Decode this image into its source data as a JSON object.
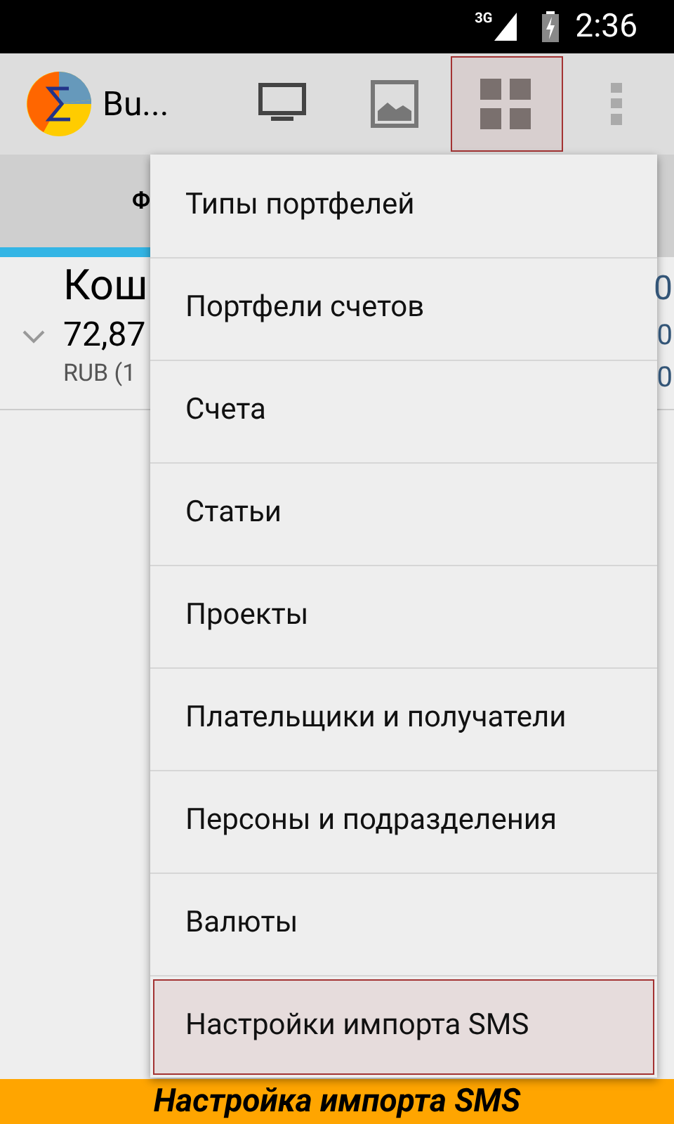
{
  "status_bar": {
    "network": "3G",
    "time": "2:36"
  },
  "action_bar": {
    "title": "Bu...",
    "actions": [
      {
        "kind": "monitor",
        "selected": false
      },
      {
        "kind": "image",
        "selected": false
      },
      {
        "kind": "grid",
        "selected": true
      }
    ]
  },
  "tabs": [
    {
      "label": "Ф",
      "selected": true
    }
  ],
  "list": [
    {
      "title": "Кош",
      "amount": "72,87",
      "currency": "RUB (1",
      "right_values": [
        "0",
        "0",
        "0"
      ]
    }
  ],
  "menu": [
    {
      "label": "Типы портфелей",
      "selected": false
    },
    {
      "label": "Портфели счетов",
      "selected": false
    },
    {
      "label": "Счета",
      "selected": false
    },
    {
      "label": "Статьи",
      "selected": false
    },
    {
      "label": "Проекты",
      "selected": false
    },
    {
      "label": "Плательщики и получатели",
      "selected": false
    },
    {
      "label": "Персоны и подразделения",
      "selected": false
    },
    {
      "label": "Валюты",
      "selected": false
    },
    {
      "label": "Настройки импорта SMS",
      "selected": true
    }
  ],
  "caption": "Настройка импорта SMS"
}
